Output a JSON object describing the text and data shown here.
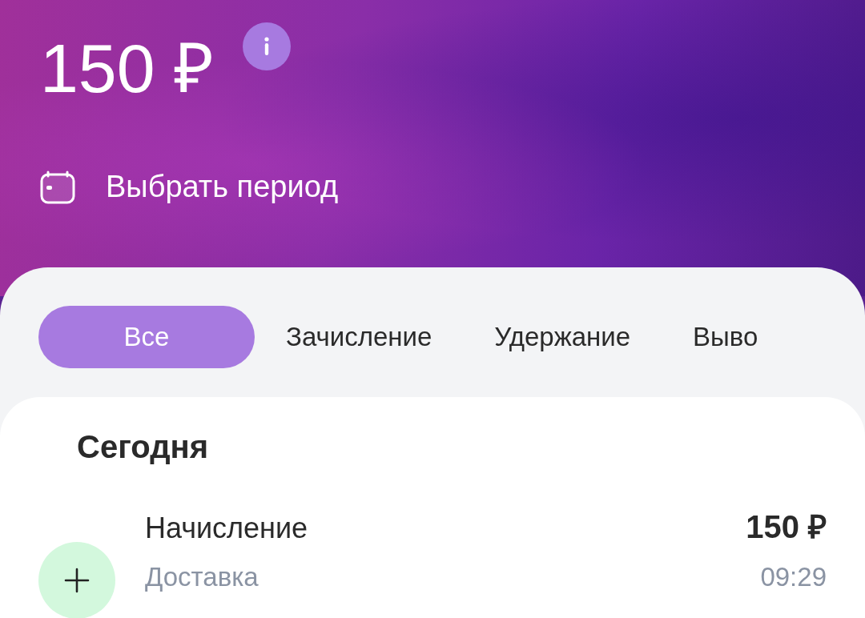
{
  "balance": {
    "amount": "150 ₽"
  },
  "period": {
    "label": "Выбрать период"
  },
  "tabs": [
    {
      "label": "Все",
      "selected": true
    },
    {
      "label": "Зачисление",
      "selected": false
    },
    {
      "label": "Удержание",
      "selected": false
    },
    {
      "label": "Выво",
      "selected": false
    }
  ],
  "groups": [
    {
      "title": "Сегодня",
      "operations": [
        {
          "kind": "income",
          "title": "Начисление",
          "subtitle": "Доставка",
          "amount": "150 ₽",
          "time": "09:29"
        }
      ]
    }
  ]
}
